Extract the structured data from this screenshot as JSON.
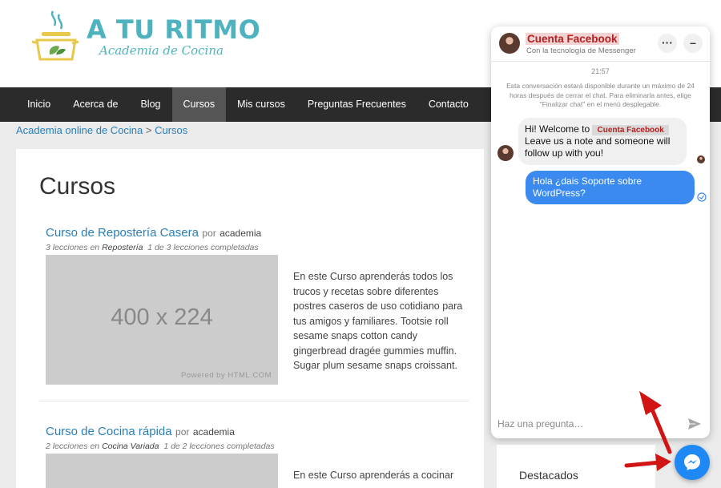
{
  "site": {
    "title": "A TU RITMO",
    "subtitle": "Academia de Cocina"
  },
  "nav": {
    "items": [
      "Inicio",
      "Acerca de",
      "Blog",
      "Cursos",
      "Mis cursos",
      "Preguntas Frecuentes",
      "Contacto"
    ],
    "active": "Cursos"
  },
  "breadcrumb": {
    "home": "Academia online de Cocina",
    "separator": " > ",
    "current": "Cursos"
  },
  "page": {
    "title": "Cursos"
  },
  "courses": [
    {
      "title": "Curso de Repostería Casera",
      "by": "por",
      "author": "academia",
      "lessons": "3 lecciones en",
      "category": "Repostería",
      "progress": "1 de 3 lecciones completadas",
      "thumb_size": "400 x 224",
      "thumb_powered": "Powered by HTML.COM",
      "description": "En este Curso aprenderás todos los trucos y recetas sobre diferentes postres caseros de uso cotidiano para tus amigos y familiares. Tootsie roll sesame snaps cotton candy gingerbread dragée gummies muffin. Sugar plum sesame snaps croissant."
    },
    {
      "title": "Curso de Cocina rápida",
      "by": "por",
      "author": "academia",
      "lessons": "2 lecciones en",
      "category": "Cocina Variada",
      "progress": "1 de 2 lecciones completadas",
      "description": "En este Curso aprenderás a cocinar"
    }
  ],
  "sidebar": {
    "featured_title": "Destacados"
  },
  "chat": {
    "name": "Cuenta Facebook",
    "powered": "Con la tecnología de Messenger",
    "time": "21:57",
    "notice": "Esta conversación estará disponible durante un máximo de 24 horas después de cerrar el chat. Para eliminarla antes, elige \"Finalizar chat\" en el menú desplegable.",
    "incoming": {
      "prefix": "Hi! Welcome to",
      "brand": "Cuenta Facebook",
      "rest": "Leave us a note and someone will follow up with you!"
    },
    "outgoing": "Hola ¿dais Soporte sobre WordPress?",
    "more_label": "···",
    "minimize_label": "–",
    "input_placeholder": "Haz una pregunta…"
  },
  "colors": {
    "brand_teal": "#4fb3bf",
    "nav_bg": "#2b2b2b",
    "link_blue": "#2a7fb8",
    "messenger_blue": "#1e88f5",
    "arrow_red": "#d11414"
  }
}
